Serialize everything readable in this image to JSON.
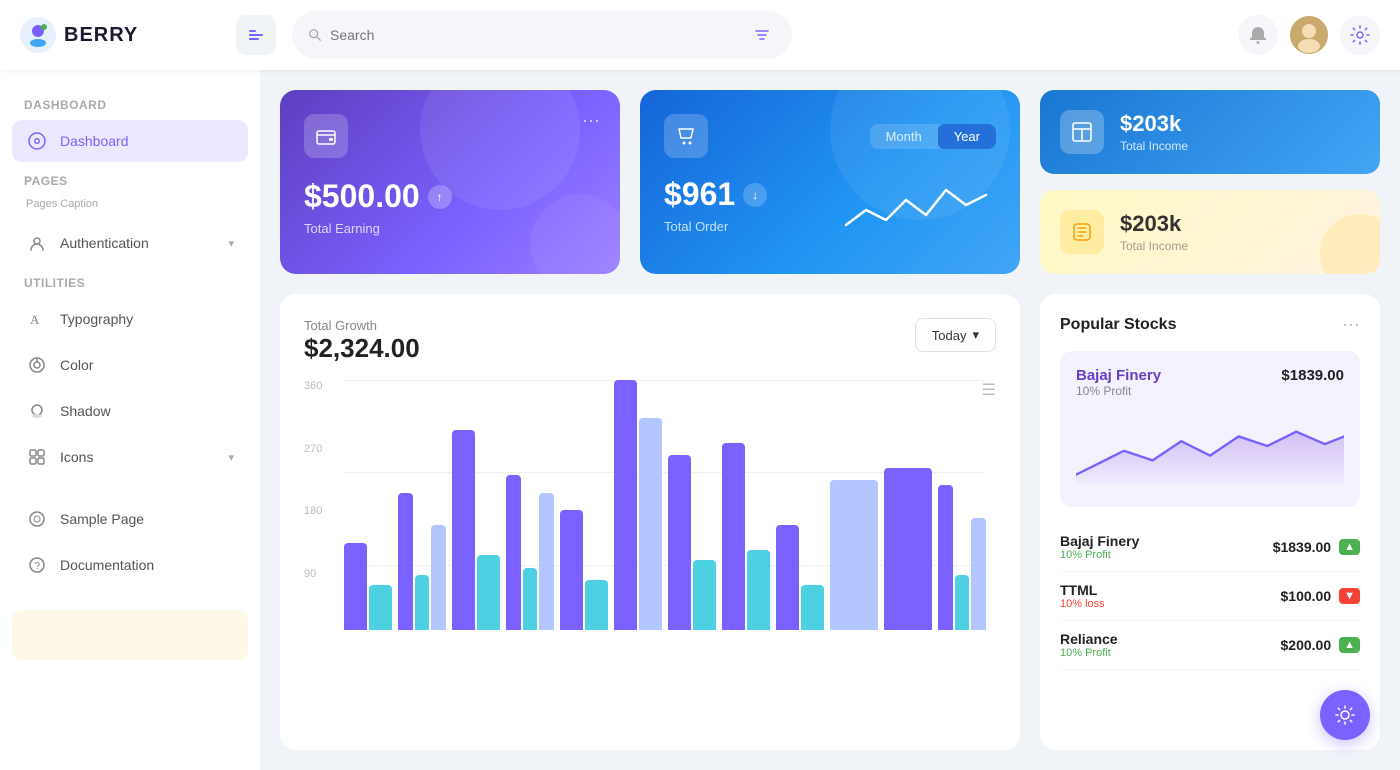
{
  "app": {
    "name": "BERRY",
    "search_placeholder": "Search"
  },
  "header": {
    "bell_icon": "🔔",
    "settings_icon": "⚙️"
  },
  "sidebar": {
    "dashboard_section": "Dashboard",
    "dashboard_item": "Dashboard",
    "pages_section": "Pages",
    "pages_caption": "Pages Caption",
    "authentication_item": "Authentication",
    "utilities_section": "Utilities",
    "typography_item": "Typography",
    "color_item": "Color",
    "shadow_item": "Shadow",
    "icons_item": "Icons",
    "sample_page_item": "Sample Page",
    "documentation_item": "Documentation"
  },
  "cards": {
    "earning": {
      "amount": "$500.00",
      "label": "Total Earning"
    },
    "order": {
      "amount": "$961",
      "label": "Total Order",
      "toggle_month": "Month",
      "toggle_year": "Year"
    },
    "total_income_blue": {
      "amount": "$203k",
      "label": "Total Income"
    },
    "total_income_yellow": {
      "amount": "$203k",
      "label": "Total Income"
    }
  },
  "growth_chart": {
    "title": "Total Growth",
    "amount": "$2,324.00",
    "button_label": "Today",
    "y_labels": [
      "360",
      "270",
      "180",
      "90"
    ],
    "bars": [
      {
        "purple": 35,
        "blue": 18,
        "light": 0
      },
      {
        "purple": 55,
        "blue": 22,
        "light": 42
      },
      {
        "purple": 80,
        "blue": 30,
        "light": 0
      },
      {
        "purple": 62,
        "blue": 25,
        "light": 55
      },
      {
        "purple": 48,
        "blue": 20,
        "light": 0
      },
      {
        "purple": 100,
        "blue": 0,
        "light": 85
      },
      {
        "purple": 70,
        "blue": 28,
        "light": 0
      },
      {
        "purple": 75,
        "blue": 32,
        "light": 0
      },
      {
        "purple": 42,
        "blue": 18,
        "light": 0
      },
      {
        "purple": 0,
        "blue": 0,
        "light": 60
      },
      {
        "purple": 65,
        "blue": 0,
        "light": 0
      },
      {
        "purple": 58,
        "blue": 22,
        "light": 45
      }
    ]
  },
  "stocks": {
    "title": "Popular Stocks",
    "featured": {
      "name": "Bajaj Finery",
      "price": "$1839.00",
      "profit_label": "10% Profit"
    },
    "items": [
      {
        "name": "Bajaj Finery",
        "sub": "10% Profit",
        "price": "$1839.00",
        "trend": "up"
      },
      {
        "name": "TTML",
        "sub": "10% loss",
        "price": "$100.00",
        "trend": "down"
      },
      {
        "name": "Reliance",
        "sub": "10% Profit",
        "price": "$200.00",
        "trend": "up"
      }
    ]
  }
}
